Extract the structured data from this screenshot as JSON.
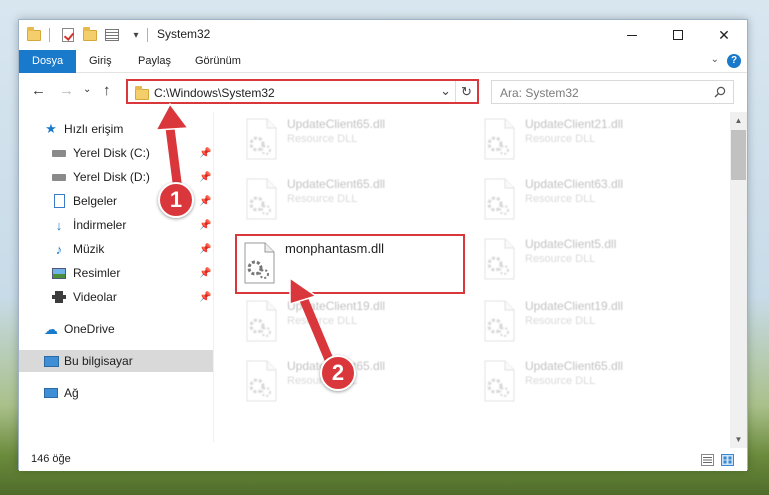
{
  "window": {
    "title": "System32",
    "minimize_glyph": "",
    "close_glyph": "✕"
  },
  "ribbon": {
    "tabs": [
      {
        "label": "Dosya",
        "active": true
      },
      {
        "label": "Giriş"
      },
      {
        "label": "Paylaş"
      },
      {
        "label": "Görünüm"
      }
    ],
    "help": "?"
  },
  "address": {
    "path": "C:\\Windows\\System32",
    "search_placeholder": "Ara: System32"
  },
  "sidebar": {
    "items": [
      {
        "label": "Hızlı erişim",
        "icon": "star-icon"
      },
      {
        "label": "Yerel Disk (C:)",
        "icon": "drive-icon"
      },
      {
        "label": "Yerel Disk (D:)",
        "icon": "drive-icon"
      },
      {
        "label": "Belgeler",
        "icon": "documents-icon"
      },
      {
        "label": "İndirmeler",
        "icon": "download-icon"
      },
      {
        "label": "Müzik",
        "icon": "music-icon"
      },
      {
        "label": "Resimler",
        "icon": "pictures-icon"
      },
      {
        "label": "Videolar",
        "icon": "video-icon"
      },
      {
        "label": "OneDrive",
        "icon": "cloud-icon"
      },
      {
        "label": "Bu bilgisayar",
        "icon": "computer-icon"
      },
      {
        "label": "Ağ",
        "icon": "network-icon"
      }
    ]
  },
  "files": {
    "left": [
      {
        "name": "UpdateClient65.dll",
        "type": "Resource DLL"
      },
      {
        "name": "UpdateClient65.dll",
        "type": "Resource DLL"
      },
      {
        "name": "monphantasm.dll",
        "type": ""
      },
      {
        "name": "UpdateClient19.dll",
        "type": "Resource DLL"
      },
      {
        "name": "UpdateClient65.dll",
        "type": "Resource DLL"
      }
    ],
    "right": [
      {
        "name": "UpdateClient21.dll",
        "type": "Resource DLL"
      },
      {
        "name": "UpdateClient63.dll",
        "type": "Resource DLL"
      },
      {
        "name": "UpdateClient5.dll",
        "type": "Resource DLL"
      },
      {
        "name": "UpdateClient19.dll",
        "type": "Resource DLL"
      },
      {
        "name": "UpdateClient65.dll",
        "type": "Resource DLL"
      }
    ]
  },
  "status": {
    "count_text": "146 öğe"
  },
  "annotations": {
    "step1": "1",
    "step2": "2",
    "color": "#d9373b"
  },
  "colors": {
    "accent": "#1979ca",
    "highlight": "#d9373b"
  }
}
